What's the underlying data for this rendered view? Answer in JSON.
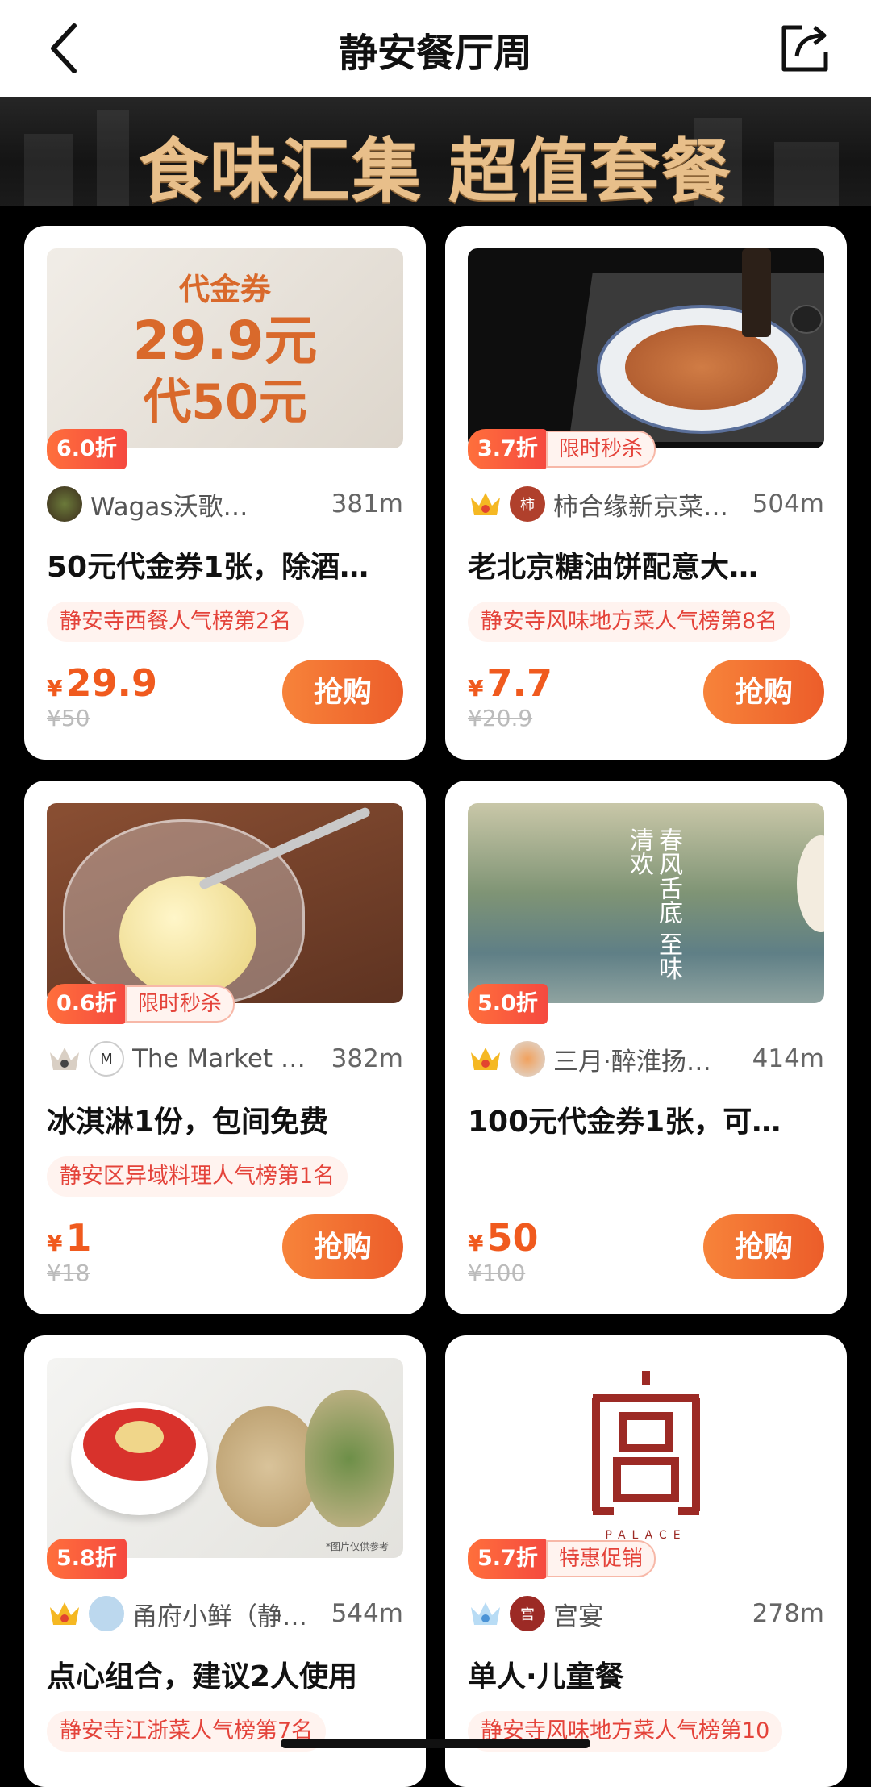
{
  "header": {
    "title": "静安餐厅周",
    "back_icon": "chevron-left-icon",
    "share_icon": "share-icon"
  },
  "banner": {
    "text": "食味汇集 超值套餐"
  },
  "cards": [
    {
      "image_text": {
        "line1": "代金券",
        "line2": "29.9元",
        "line3": "代50元"
      },
      "discount": "6.0折",
      "promo": "",
      "shop": "Wagas沃歌…",
      "distance": "381m",
      "deal": "50元代金券1张，除酒…",
      "rank": "静安寺西餐人气榜第2名",
      "price_symbol": "¥",
      "price": "29.9",
      "original": "¥50",
      "buy": "抢购"
    },
    {
      "image_text": {},
      "discount": "3.7折",
      "promo": "限时秒杀",
      "shop": "柿合缘新京菜…",
      "distance": "504m",
      "deal": "老北京糖油饼配意大…",
      "rank": "静安寺风味地方菜人气榜第8名",
      "price_symbol": "¥",
      "price": "7.7",
      "original": "¥20.9",
      "buy": "抢购"
    },
    {
      "image_text": {},
      "discount": "0.6折",
      "promo": "限时秒杀",
      "shop": "The Market …",
      "distance": "382m",
      "deal": "冰淇淋1份，包间免费",
      "rank": "静安区异域料理人气榜第1名",
      "price_symbol": "¥",
      "price": "1",
      "original": "¥18",
      "buy": "抢购"
    },
    {
      "image_text": {
        "poem": "春风舌底 至味清欢"
      },
      "discount": "5.0折",
      "promo": "",
      "shop": "三月·醉淮扬…",
      "distance": "414m",
      "deal": "100元代金券1张，可…",
      "rank": "",
      "price_symbol": "¥",
      "price": "50",
      "original": "¥100",
      "buy": "抢购"
    },
    {
      "image_text": {
        "note": "*图片仅供参考"
      },
      "discount": "5.8折",
      "promo": "",
      "shop": "甬府小鲜（静…",
      "distance": "544m",
      "deal": "点心组合，建议2人使用",
      "rank": "静安寺江浙菜人气榜第7名",
      "price_symbol": "",
      "price": "",
      "original": "",
      "buy": ""
    },
    {
      "image_text": {
        "logo": "PALACE"
      },
      "discount": "5.7折",
      "promo": "特惠促销",
      "shop": "宫宴",
      "distance": "278m",
      "deal": "单人·儿童餐",
      "rank": "静安寺风味地方菜人气榜第10",
      "price_symbol": "",
      "price": "",
      "original": "",
      "buy": ""
    }
  ],
  "colors": {
    "accent": "#f05a1e",
    "badge": "#f5493f",
    "bg": "#000000"
  }
}
